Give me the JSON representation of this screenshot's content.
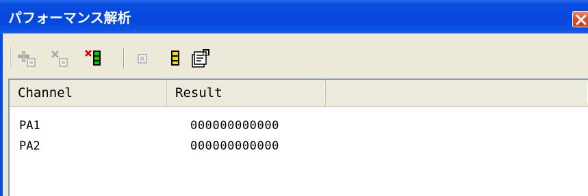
{
  "window": {
    "title": "パフォーマンス解析"
  },
  "toolbar": {
    "buttons": [
      {
        "name": "add-range-button",
        "icon": "add-range-icon",
        "enabled": false
      },
      {
        "name": "delete-range-button",
        "icon": "delete-range-icon",
        "enabled": false
      },
      {
        "name": "delete-all-ranges-button",
        "icon": "delete-all-ranges-icon",
        "enabled": true
      },
      {
        "name": "stop-measurement-button",
        "icon": "stop-icon",
        "enabled": false
      },
      {
        "name": "start-measurement-button",
        "icon": "start-icon",
        "enabled": true
      },
      {
        "name": "properties-button",
        "icon": "properties-icon",
        "enabled": true
      }
    ]
  },
  "table": {
    "columns": [
      {
        "label": "Channel"
      },
      {
        "label": "Result"
      },
      {
        "label": ""
      }
    ],
    "rows": [
      {
        "channel": "PA1",
        "result": "000000000000"
      },
      {
        "channel": "PA2",
        "result": "000000000000"
      }
    ]
  },
  "colors": {
    "title_bar": "#0a4ee0",
    "close_button": "#e0502c",
    "toolbar_bg": "#ece9d8",
    "list_bg": "#ffffff",
    "header_bg": "#ebeadb"
  }
}
